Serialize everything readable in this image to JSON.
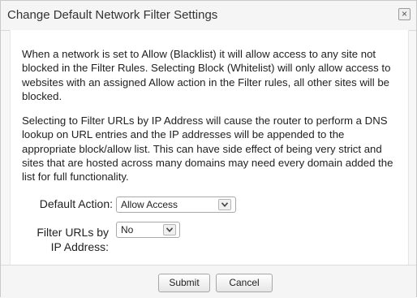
{
  "dialog": {
    "title": "Change Default Network Filter Settings",
    "close_label": "×"
  },
  "body": {
    "paragraph1": "When a network is set to Allow (Blacklist) it will allow access to any site not blocked in the Filter Rules. Selecting Block (Whitelist) will only allow access to websites with an assigned Allow action in the Filter rules, all other sites will be blocked.",
    "paragraph2": "Selecting to Filter URLs by IP Address will cause the router to perform a DNS lookup on URL entries and the IP addresses will be appended to the appropriate block/allow list. This can have side effect of being very strict and sites that are hosted across many domains may need every domain added the list for full functionality."
  },
  "form": {
    "default_action": {
      "label": "Default Action:",
      "selected": "Allow Access"
    },
    "filter_urls": {
      "label_line1": "Filter URLs by",
      "label_line2": "IP Address:",
      "selected": "No"
    }
  },
  "footer": {
    "submit_label": "Submit",
    "cancel_label": "Cancel"
  },
  "icons": {
    "close": "close-icon",
    "dropdown": "chevron-down-icon"
  }
}
